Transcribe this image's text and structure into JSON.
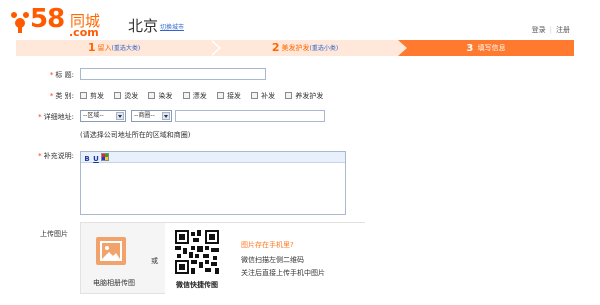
{
  "header": {
    "logo_number": "58",
    "logo_cn": "同城",
    "logo_com": ".com",
    "city": "北京",
    "switch_city": "切换城市",
    "login": "登录",
    "register": "注册"
  },
  "steps": [
    {
      "num": "1",
      "label": "留入",
      "sub": "(重选大类)"
    },
    {
      "num": "2",
      "label": "美发护发",
      "sub": "(重选小类)"
    },
    {
      "num": "3",
      "label": "填写信息",
      "sub": ""
    }
  ],
  "form": {
    "title_label": "标  题:",
    "title_value": "",
    "category_label": "类  别:",
    "categories": [
      "剪发",
      "烫发",
      "染发",
      "漂发",
      "接发",
      "补发",
      "养发护发"
    ],
    "address_label": "详细地址:",
    "district_select": "--区域--",
    "area_select": "--商圈--",
    "address_value": "",
    "address_hint": "(请选择公司地址所在的区域和商圈)",
    "desc_label": "补充说明:",
    "editor_buttons": [
      "B",
      "U"
    ]
  },
  "upload": {
    "label": "上传图片",
    "pc_label": "电脑相册传图",
    "or": "或",
    "qr_label": "微信快捷传图",
    "qr_title": "图片存在手机里?",
    "qr_line1": "微信扫描左侧二维码",
    "qr_line2": "关注后直接上传手机中图片"
  },
  "colors": {
    "brand": "#ff5a00",
    "step_inactive_bg": "#ffe8d9",
    "step_active_bg": "#ff7a2e",
    "link": "#3366cc"
  }
}
